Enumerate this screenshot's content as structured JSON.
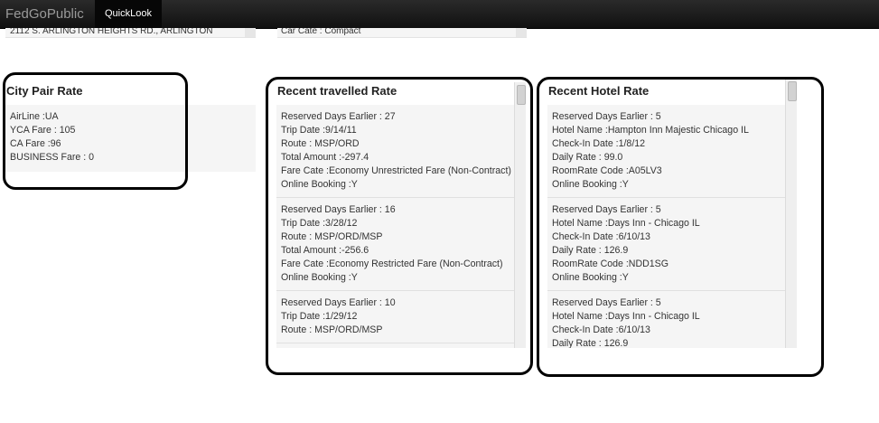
{
  "nav": {
    "brand": "FedGoPublic",
    "tab": "QuickLook"
  },
  "top_panels": {
    "address": "2112 S. ARLINGTON HEIGHTS RD., ARLINGTON",
    "car": "Car Cate : Compact"
  },
  "city_pair": {
    "title": "City Pair Rate",
    "lines": [
      "AirLine :UA",
      "YCA Fare : 105",
      "CA Fare :96",
      "BUSINESS Fare : 0"
    ]
  },
  "travel": {
    "title": "Recent travelled Rate",
    "entries": [
      [
        "Reserved Days Earlier : 27",
        "Trip Date :9/14/11",
        "Route : MSP/ORD",
        "Total Amount :-297.4",
        "Fare Cate :Economy Unrestricted Fare (Non-Contract)",
        "Online Booking :Y"
      ],
      [
        "Reserved Days Earlier : 16",
        "Trip Date :3/28/12",
        "Route : MSP/ORD/MSP",
        "Total Amount :-256.6",
        "Fare Cate :Economy Restricted Fare (Non-Contract)",
        "Online Booking :Y"
      ],
      [
        "Reserved Days Earlier : 10",
        "Trip Date :1/29/12",
        "Route : MSP/ORD/MSP"
      ]
    ]
  },
  "hotel": {
    "title": "Recent Hotel Rate",
    "entries": [
      [
        "Reserved Days Earlier : 5",
        "Hotel Name :Hampton Inn Majestic Chicago IL",
        "Check-In Date :1/8/12",
        "Daily Rate : 99.0",
        "RoomRate Code :A05LV3",
        "Online Booking :Y"
      ],
      [
        "Reserved Days Earlier : 5",
        "Hotel Name :Days Inn - Chicago IL",
        "Check-In Date :6/10/13",
        "Daily Rate : 126.9",
        "RoomRate Code :NDD1SG",
        "Online Booking :Y"
      ],
      [
        "Reserved Days Earlier : 5",
        "Hotel Name :Days Inn - Chicago IL",
        "Check-In Date :6/10/13",
        "Daily Rate : 126.9"
      ]
    ]
  }
}
